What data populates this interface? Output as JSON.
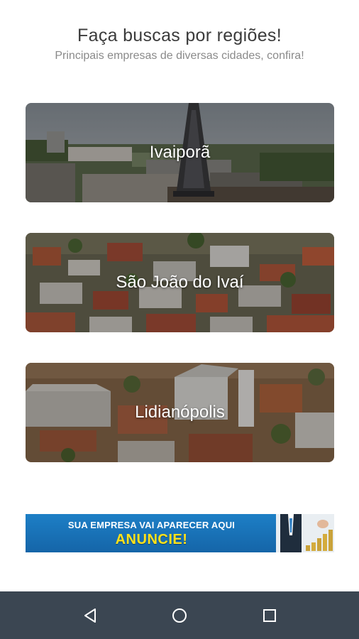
{
  "header": {
    "title": "Faça buscas por regiões!",
    "subtitle": "Principais empresas de diversas cidades, confira!"
  },
  "regions": [
    {
      "label": "Ivaiporã"
    },
    {
      "label": "São João do Ivaí"
    },
    {
      "label": "Lidianópolis"
    }
  ],
  "ad_banner": {
    "line1": "SUA EMPRESA VAI APARECER AQUI",
    "line2": "ANUNCIE!",
    "colors": {
      "background": "#1d7fc6",
      "highlight": "#ffe21a"
    }
  },
  "navbar": {
    "icons": [
      "back-icon",
      "home-icon",
      "recent-apps-icon"
    ],
    "background": "#3b4652"
  }
}
